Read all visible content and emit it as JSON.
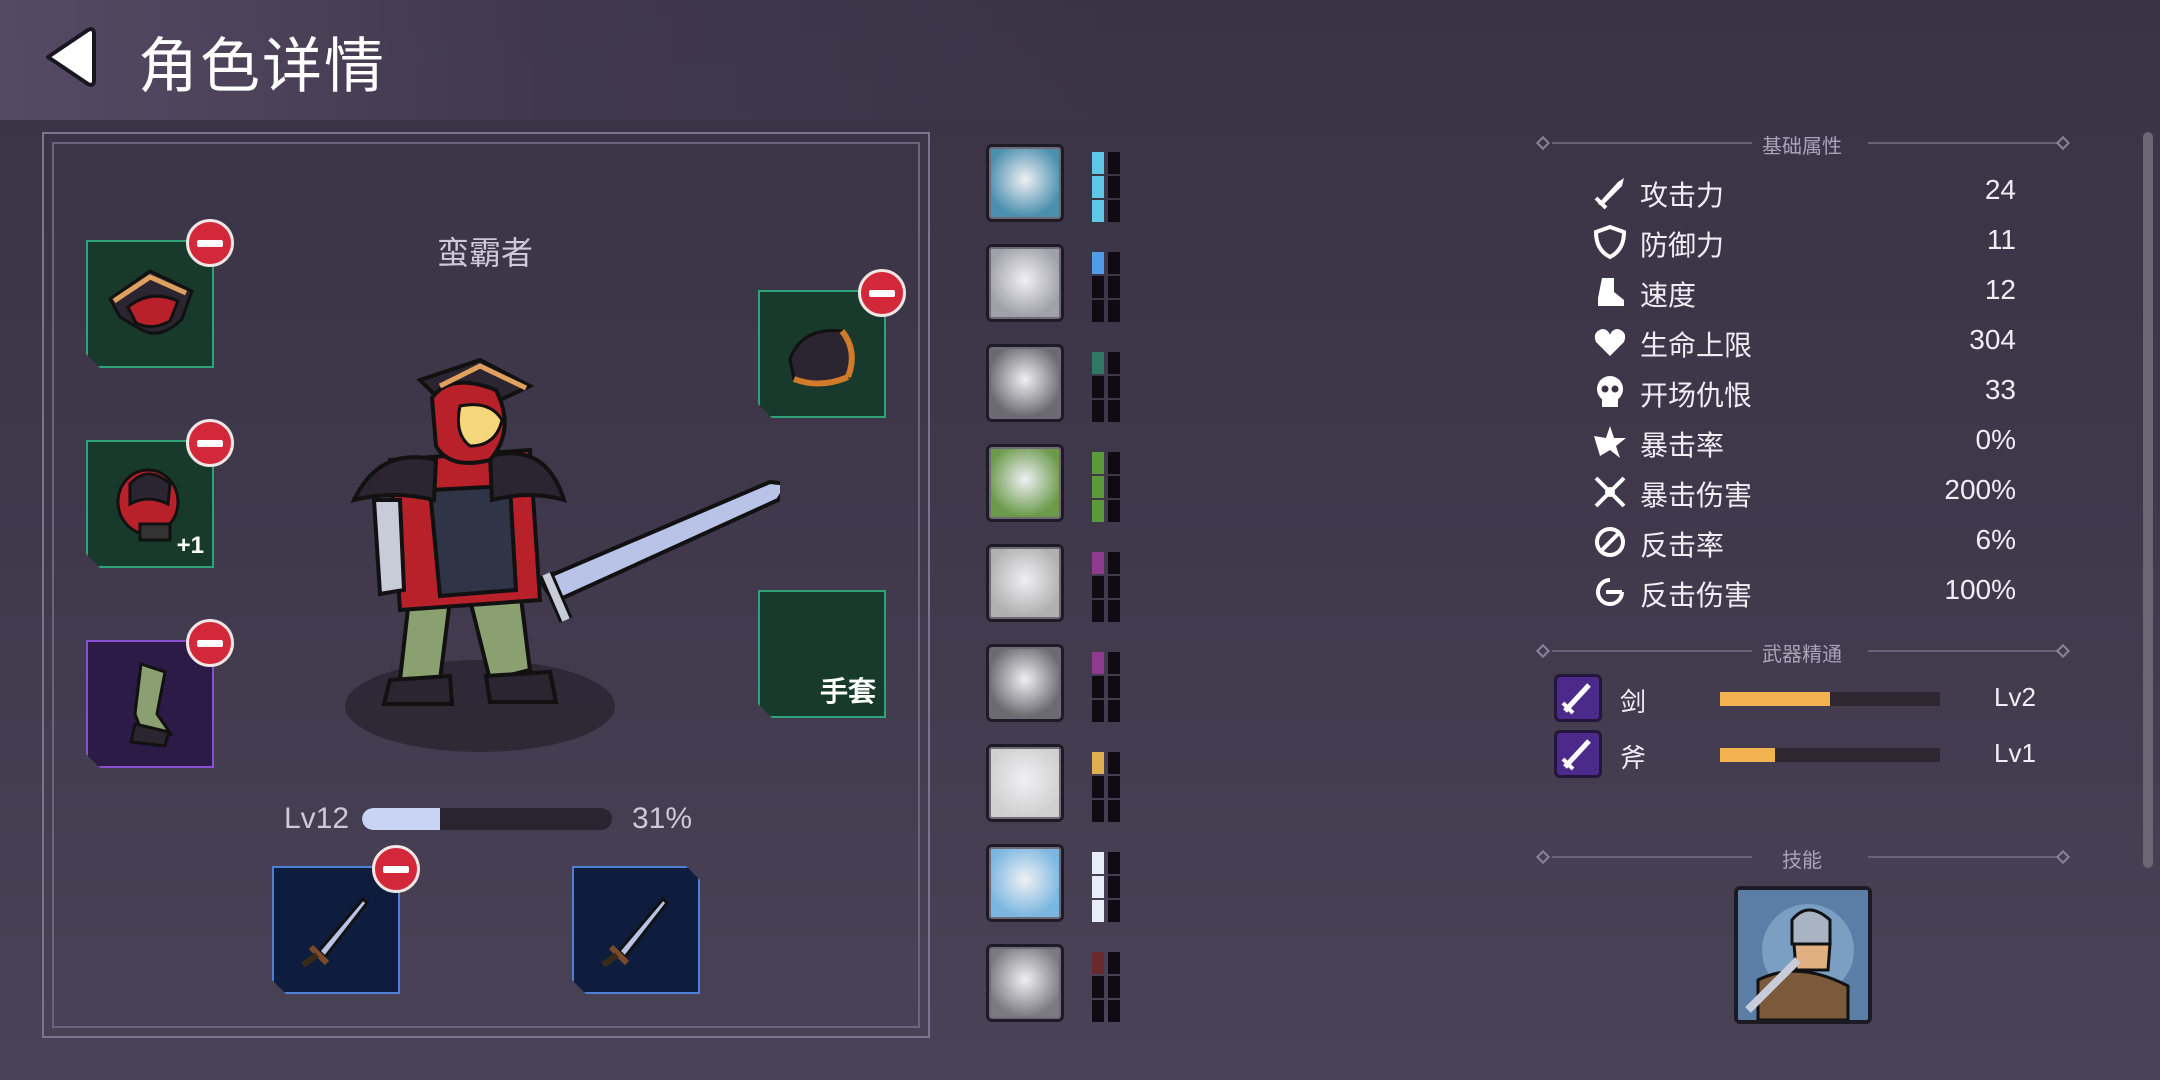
{
  "header": {
    "title": "角色详情"
  },
  "character": {
    "name": "蛮霸者",
    "level_label": "Lv12",
    "xp_percent_label": "31%",
    "xp_fraction": 0.31,
    "slots": {
      "gloves_label": "手套",
      "body_plus": "+1"
    }
  },
  "traits": [
    {
      "name": "barbarian-trait-icon",
      "pip_color": "#5ec8e8",
      "pips_filled": 3
    },
    {
      "name": "armor-trait-icon",
      "pip_color": "#4f9de8",
      "pips_filled": 1
    },
    {
      "name": "shield-trait-icon",
      "pip_color": "#2f7a62",
      "pips_filled": 1
    },
    {
      "name": "viking-trait-icon",
      "pip_color": "#5a9a3a",
      "pips_filled": 3
    },
    {
      "name": "scream-trait-icon",
      "pip_color": "#8e3a8e",
      "pips_filled": 1
    },
    {
      "name": "hooded-trait-icon",
      "pip_color": "#8e3a8e",
      "pips_filled": 1
    },
    {
      "name": "hand-trait-icon",
      "pip_color": "#e0b050",
      "pips_filled": 1
    },
    {
      "name": "wings-trait-icon",
      "pip_color": "#e8eef8",
      "pips_filled": 3
    },
    {
      "name": "beast-trait-icon",
      "pip_color": "#6a2a2a",
      "pips_filled": 1
    }
  ],
  "stats": {
    "section_title": "基础属性",
    "items": [
      {
        "icon": "sword-icon",
        "label": "攻击力",
        "value": "24"
      },
      {
        "icon": "shield-icon",
        "label": "防御力",
        "value": "11"
      },
      {
        "icon": "boot-icon",
        "label": "速度",
        "value": "12"
      },
      {
        "icon": "heart-icon",
        "label": "生命上限",
        "value": "304"
      },
      {
        "icon": "skull-icon",
        "label": "开场仇恨",
        "value": "33"
      },
      {
        "icon": "crit-icon",
        "label": "暴击率",
        "value": "0%"
      },
      {
        "icon": "crit-damage-icon",
        "label": "暴击伤害",
        "value": "200%"
      },
      {
        "icon": "counter-icon",
        "label": "反击率",
        "value": "6%"
      },
      {
        "icon": "counter-damage-icon",
        "label": "反击伤害",
        "value": "100%"
      }
    ]
  },
  "weapons": {
    "section_title": "武器精通",
    "items": [
      {
        "icon": "sword-mastery-icon",
        "label": "剑",
        "level": "Lv2",
        "progress": 0.5
      },
      {
        "icon": "axe-mastery-icon",
        "label": "斧",
        "level": "Lv1",
        "progress": 0.25
      }
    ]
  },
  "skills": {
    "section_title": "技能"
  },
  "colors": {
    "accent_gold": "#f2b24f",
    "remove_red": "#d3283a",
    "slot_green": "#2fa27a"
  }
}
